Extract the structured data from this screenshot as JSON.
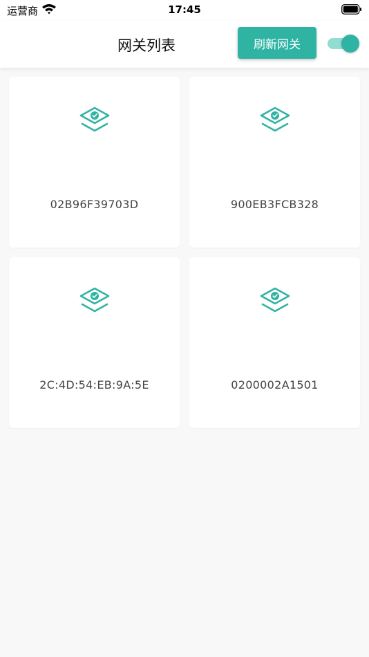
{
  "status_bar": {
    "carrier": "运营商",
    "time": "17:45",
    "icons": [
      "wifi-icon",
      "battery-icon"
    ]
  },
  "header": {
    "title": "网关列表",
    "refresh_label": "刷新网关",
    "toggle_on": true
  },
  "colors": {
    "accent": "#2fb3a3",
    "toggle_track": "#92dcd1",
    "background": "#f8f8f8",
    "card": "#ffffff"
  },
  "gateways": [
    {
      "id": "02B96F39703D",
      "icon": "gateway-icon"
    },
    {
      "id": "900EB3FCB328",
      "icon": "gateway-icon"
    },
    {
      "id": "2C:4D:54:EB:9A:5E",
      "icon": "gateway-icon"
    },
    {
      "id": "0200002A1501",
      "icon": "gateway-icon"
    }
  ]
}
